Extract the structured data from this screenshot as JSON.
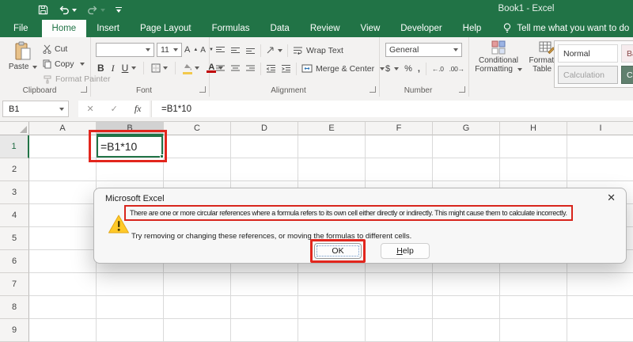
{
  "window": {
    "title": "Book1  -  Excel"
  },
  "tabs": [
    "File",
    "Home",
    "Insert",
    "Page Layout",
    "Formulas",
    "Data",
    "Review",
    "View",
    "Developer",
    "Help"
  ],
  "tell_me": "Tell me what you want to do",
  "ribbon": {
    "clipboard": {
      "group_label": "Clipboard",
      "paste": "Paste",
      "cut": "Cut",
      "copy": "Copy",
      "format_painter": "Format Painter"
    },
    "font": {
      "group_label": "Font",
      "name_value": "",
      "size_value": "11",
      "bold": "B",
      "italic": "I",
      "underline": "U",
      "grow": "A",
      "shrink": "A"
    },
    "alignment": {
      "group_label": "Alignment",
      "wrap_text": "Wrap Text",
      "merge_center": "Merge & Center"
    },
    "number": {
      "group_label": "Number",
      "format_value": "General",
      "currency": "$",
      "percent": "%",
      "comma": ",",
      "inc_decimal": "←.0",
      "dec_decimal": ".00→"
    },
    "styles": {
      "conditional_formatting": "Conditional Formatting",
      "format_as_table": "Format as Table",
      "gallery": [
        "Normal",
        "Bad",
        "Calculation",
        "Check Cell"
      ]
    }
  },
  "formula_bar": {
    "name_box": "B1",
    "cancel": "✕",
    "enter": "✓",
    "insert_function": "fx",
    "formula": "=B1*10"
  },
  "grid": {
    "columns": [
      "A",
      "B",
      "C",
      "D",
      "E",
      "F",
      "G",
      "H",
      "I"
    ],
    "rows": [
      "1",
      "2",
      "3",
      "4",
      "5",
      "6",
      "7",
      "8",
      "9"
    ],
    "selected_column": "B",
    "selected_row": "1",
    "active_cell_value": "=B1*10"
  },
  "dialog": {
    "title": "Microsoft Excel",
    "close": "✕",
    "message_primary": "There are one or more circular references where a formula refers to its own cell either directly or indirectly. This might cause them to calculate incorrectly.",
    "message_secondary": "Try removing or changing these references, or moving the formulas to different cells.",
    "ok": "OK",
    "help": "Help"
  },
  "colors": {
    "excel_green": "#217346",
    "annotation_red": "#e2261d",
    "warning_yellow": "#fdc92c",
    "ribbon_bg": "#f3f2f1"
  },
  "icons": {
    "save": "floppy-disk",
    "undo": "curved-arrow-left",
    "redo": "curved-arrow-right",
    "lightbulb": "bulb-outline",
    "paste": "clipboard-with-page",
    "cut": "scissors",
    "copy": "two-pages",
    "format_painter": "paintbrush",
    "warning": "yellow-triangle-exclamation",
    "dropdown_caret": "▾"
  }
}
